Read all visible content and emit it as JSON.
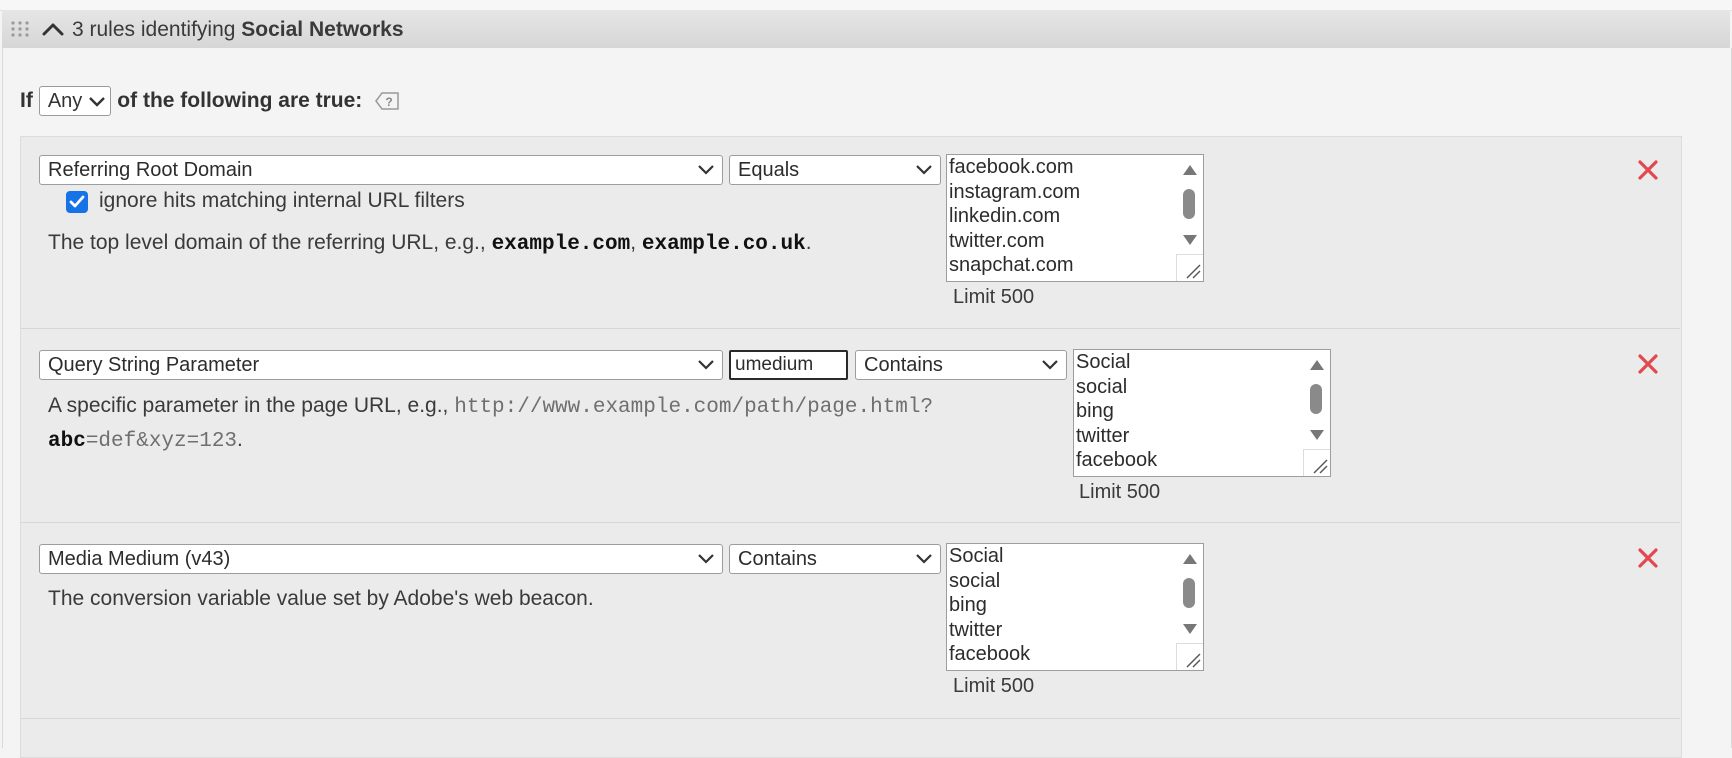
{
  "group": {
    "count_text": "3 rules identifying",
    "name": "Social Networks"
  },
  "condition": {
    "prefix": "If",
    "match_value": "Any",
    "suffix": "of the following are true:"
  },
  "rules": [
    {
      "dimension": "Referring Root Domain",
      "operator": "Equals",
      "checkbox": {
        "checked": true,
        "label": "ignore hits matching internal URL filters"
      },
      "description": {
        "text": "The top level domain of the referring URL, e.g.,",
        "example1": "example.com",
        "sep": ",",
        "example2": "example.co.uk",
        "end": "."
      },
      "values": [
        "facebook.com",
        "instagram.com",
        "linkedin.com",
        "twitter.com",
        "snapchat.com"
      ],
      "limit": "Limit 500"
    },
    {
      "dimension": "Query String Parameter",
      "parameter": "umedium",
      "operator": "Contains",
      "description": {
        "text": "A specific parameter in the page URL, e.g.,",
        "url": "http://www.example.com/path/page.html?",
        "param": "abc",
        "rest": "=def&xyz=123",
        "end": "."
      },
      "values": [
        "Social",
        "social",
        "bing",
        "twitter",
        "facebook"
      ],
      "limit": "Limit 500"
    },
    {
      "dimension": "Media Medium (v43)",
      "operator": "Contains",
      "description": {
        "text": "The conversion variable value set by Adobe's web beacon."
      },
      "values": [
        "Social",
        "social",
        "bing",
        "twitter",
        "facebook"
      ],
      "limit": "Limit 500"
    }
  ],
  "icons": {
    "drag": "drag-handle-icon",
    "collapse": "chevron-up-icon",
    "help": "help-icon",
    "delete": "delete-x-icon",
    "dropdown": "chevron-down-icon"
  },
  "colors": {
    "delete": "#e34850",
    "checkbox": "#1473e6"
  }
}
